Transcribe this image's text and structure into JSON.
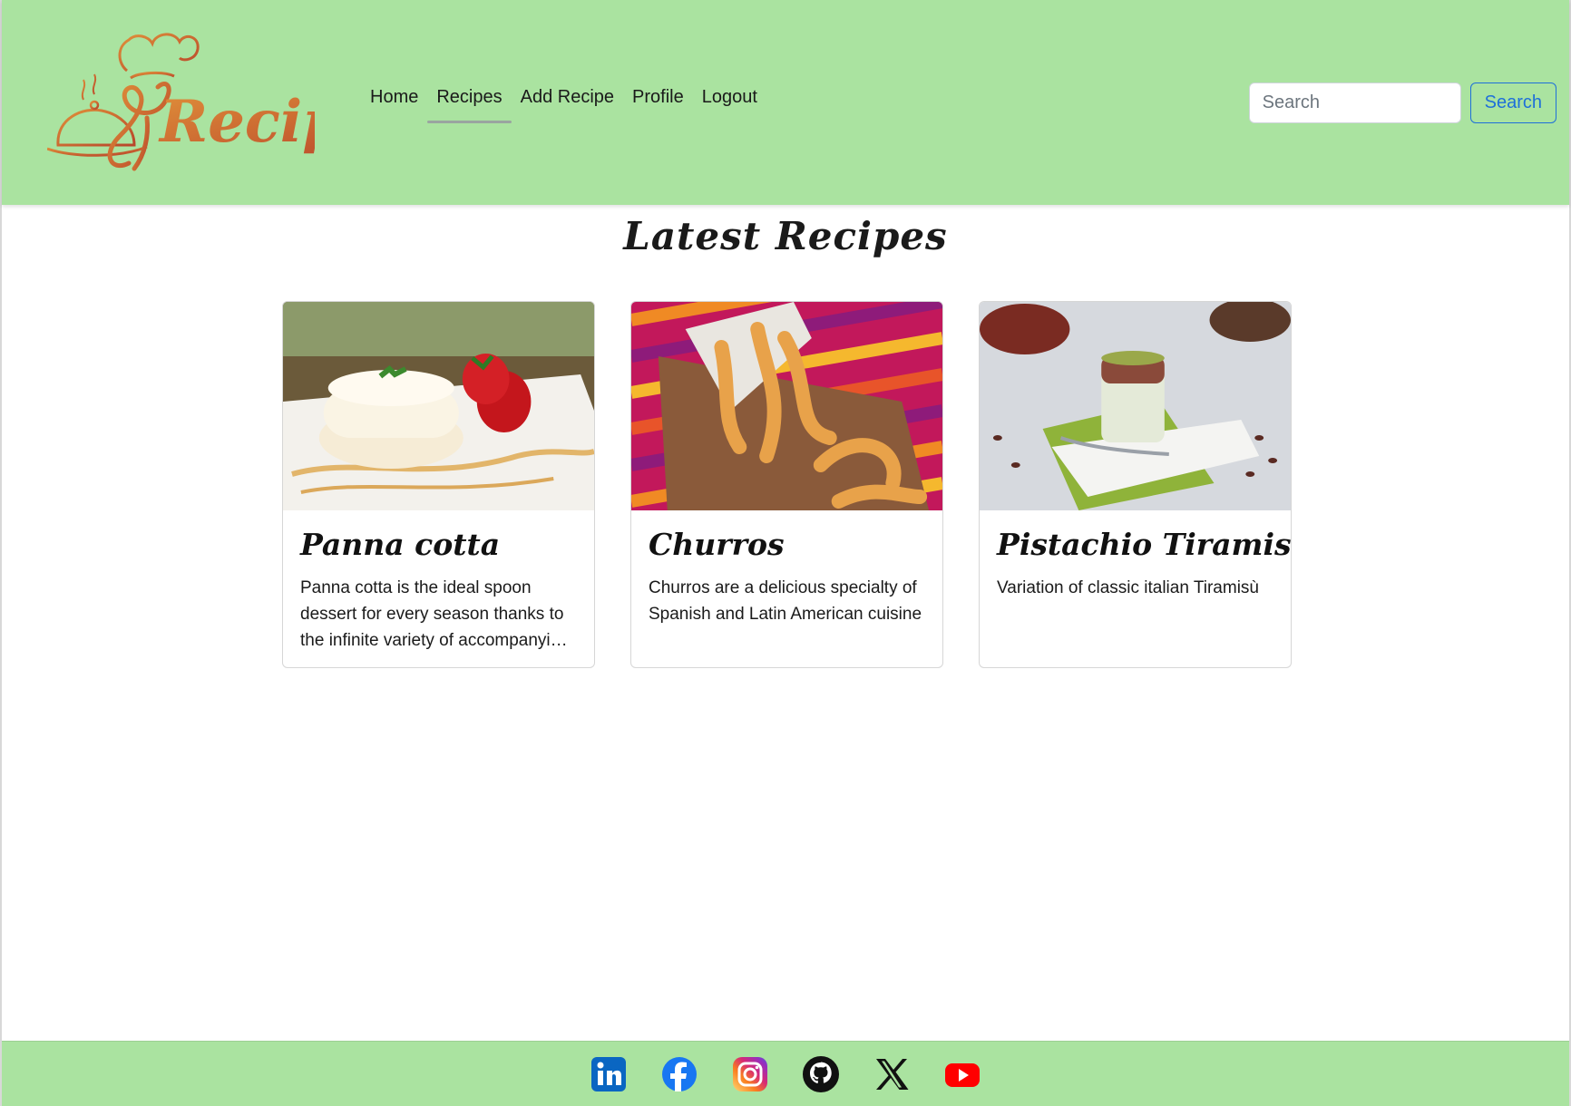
{
  "header": {
    "logo_text": "Recipes",
    "nav": [
      {
        "label": "Home",
        "active": false
      },
      {
        "label": "Recipes",
        "active": true
      },
      {
        "label": "Add Recipe",
        "active": false
      },
      {
        "label": "Profile",
        "active": false
      },
      {
        "label": "Logout",
        "active": false
      }
    ],
    "search": {
      "placeholder": "Search",
      "button_label": "Search"
    }
  },
  "main": {
    "title": "Latest Recipes",
    "cards": [
      {
        "title": "Panna cotta",
        "description": "Panna cotta is the ideal spoon dessert for every season thanks to the infinite variety of accompanying sauces and toppings"
      },
      {
        "title": "Churros",
        "description": "Churros are a delicious specialty of Spanish and Latin American cuisine"
      },
      {
        "title": "Pistachio Tiramisù",
        "description": "Variation of classic italian Tiramisù"
      }
    ]
  },
  "footer": {
    "social": [
      "linkedin-icon",
      "facebook-icon",
      "instagram-icon",
      "github-icon",
      "x-icon",
      "youtube-icon"
    ]
  },
  "colors": {
    "navbar": "#aae3a0",
    "accent_blue": "#1e6fd9",
    "logo_orange": "#d9702a"
  }
}
